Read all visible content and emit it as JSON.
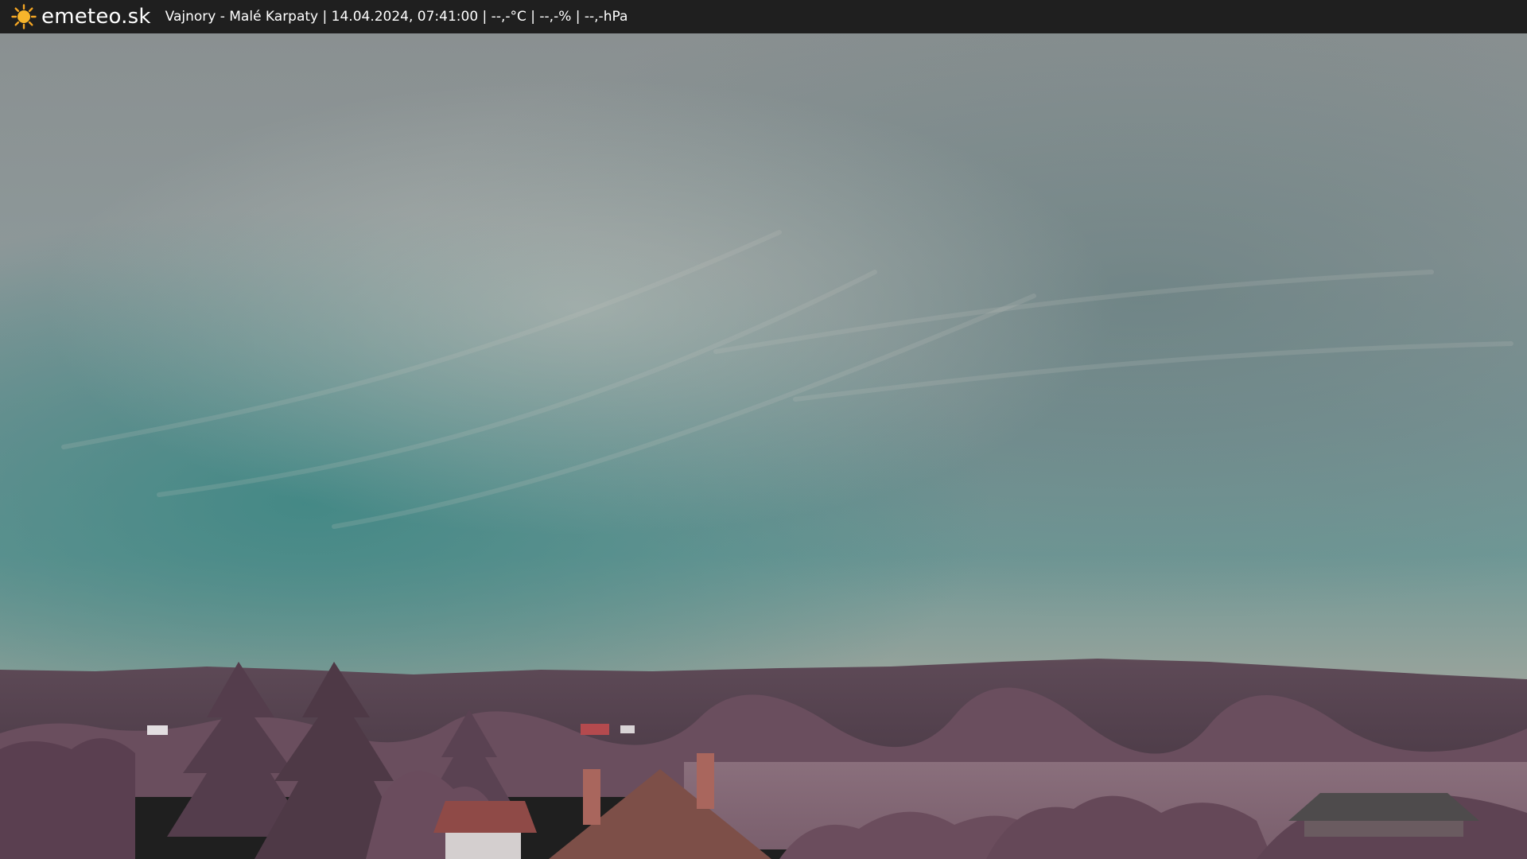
{
  "header": {
    "brand": "emeteo.sk",
    "caption": "Vajnory - Malé Karpaty | 14.04.2024, 07:41:00 | --,-°C | --,-% | --,-hPa",
    "logo_icon": "sun-icon"
  },
  "colors": {
    "bar_background": "#1f1f1f",
    "sun": "#f5a623",
    "sky_teal": "#4f8c88",
    "sky_grey": "#8b9596",
    "hills": "#5a4652",
    "foliage": "#6e4d5e"
  }
}
